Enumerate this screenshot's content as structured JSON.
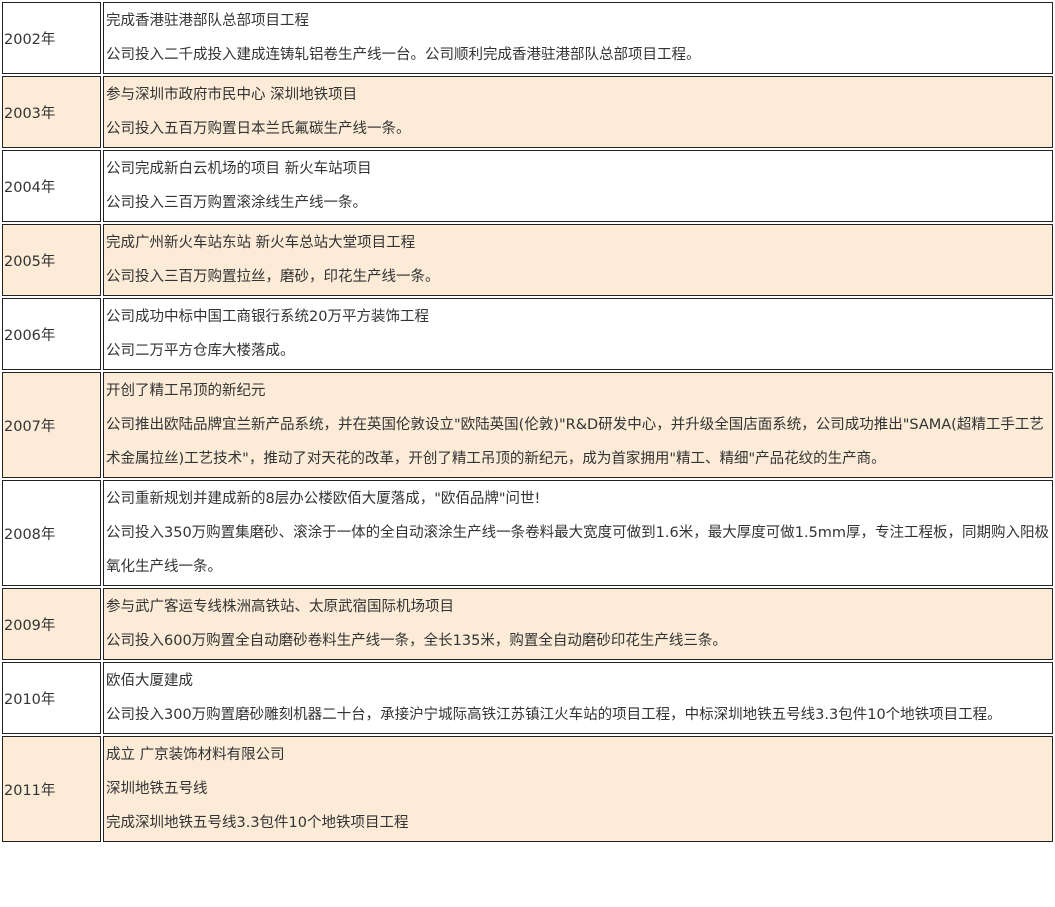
{
  "timeline": {
    "rows": [
      {
        "year": "2002年",
        "lines": [
          "完成香港驻港部队总部项目工程",
          "公司投入二千成投入建成连铸轧铝卷生产线一台。公司顺利完成香港驻港部队总部项目工程。"
        ]
      },
      {
        "year": "2003年",
        "lines": [
          "参与深圳市政府市民中心 深圳地铁项目",
          "公司投入五百万购置日本兰氏氟碳生产线一条。"
        ]
      },
      {
        "year": "2004年",
        "lines": [
          "公司完成新白云机场的项目 新火车站项目",
          "公司投入三百万购置滚涂线生产线一条。"
        ]
      },
      {
        "year": "2005年",
        "lines": [
          "完成广州新火车站东站 新火车总站大堂项目工程",
          "公司投入三百万购置拉丝，磨砂，印花生产线一条。"
        ]
      },
      {
        "year": "2006年",
        "lines": [
          "公司成功中标中国工商银行系统20万平方装饰工程",
          "公司二万平方仓库大楼落成。"
        ]
      },
      {
        "year": "2007年",
        "lines": [
          "开创了精工吊顶的新纪元",
          "公司推出欧陆品牌宜兰新产品系统，并在英国伦敦设立\"欧陆英国(伦敦)\"R&D研发中心，并升级全国店面系统，公司成功推出\"SAMA(超精工手工艺术金属拉丝)工艺技术\"，推动了对天花的改革，开创了精工吊顶的新纪元，成为首家拥用\"精工、精细\"产品花纹的生产商。"
        ]
      },
      {
        "year": "2008年",
        "lines": [
          "公司重新规划并建成新的8层办公楼欧佰大厦落成，\"欧佰品牌\"问世!",
          "公司投入350万购置集磨砂、滚涂于一体的全自动滚涂生产线一条卷料最大宽度可做到1.6米，最大厚度可做1.5mm厚，专注工程板，同期购入阳极氧化生产线一条。"
        ]
      },
      {
        "year": "2009年",
        "lines": [
          "参与武广客运专线株洲高铁站、太原武宿国际机场项目",
          "公司投入600万购置全自动磨砂卷料生产线一条，全长135米，购置全自动磨砂印花生产线三条。"
        ]
      },
      {
        "year": "2010年",
        "lines": [
          "欧佰大厦建成",
          "公司投入300万购置磨砂雕刻机器二十台，承接沪宁城际高铁江苏镇江火车站的项目工程，中标深圳地铁五号线3.3包件10个地铁项目工程。"
        ]
      },
      {
        "year": "2011年",
        "lines": [
          "成立 广京装饰材料有限公司",
          "深圳地铁五号线",
          "完成深圳地铁五号线3.3包件10个地铁项目工程"
        ]
      }
    ]
  }
}
